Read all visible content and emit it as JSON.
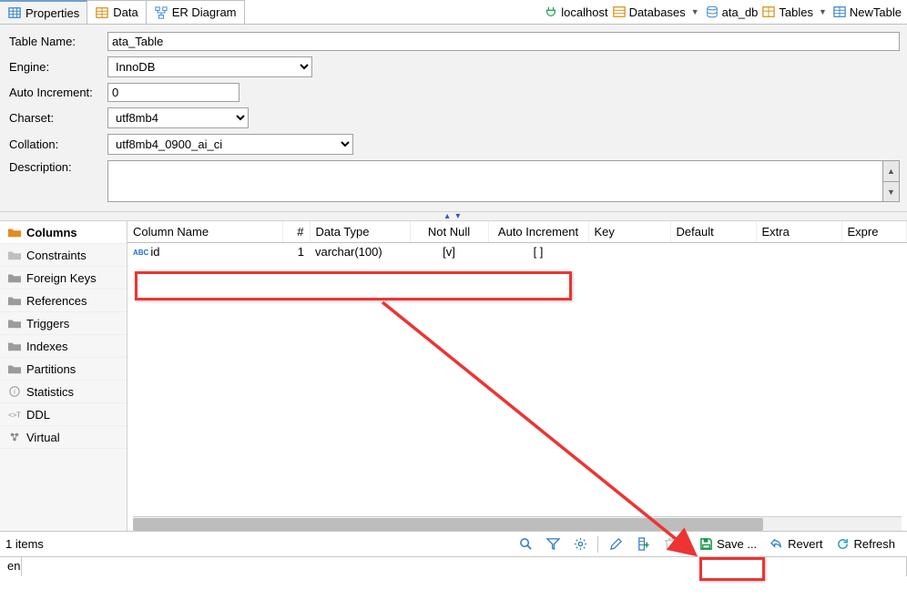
{
  "tabs": {
    "properties": "Properties",
    "data": "Data",
    "er": "ER Diagram"
  },
  "breadcrumb": {
    "conn": "localhost",
    "databases": "Databases",
    "db": "ata_db",
    "tables": "Tables",
    "table": "NewTable"
  },
  "form": {
    "labels": {
      "tablename": "Table Name:",
      "engine": "Engine:",
      "autoinc": "Auto Increment:",
      "charset": "Charset:",
      "collation": "Collation:",
      "description": "Description:"
    },
    "values": {
      "tablename": "ata_Table",
      "engine": "InnoDB",
      "autoinc": "0",
      "charset": "utf8mb4",
      "collation": "utf8mb4_0900_ai_ci",
      "description": ""
    }
  },
  "categories": [
    "Columns",
    "Constraints",
    "Foreign Keys",
    "References",
    "Triggers",
    "Indexes",
    "Partitions",
    "Statistics",
    "DDL",
    "Virtual"
  ],
  "grid": {
    "headers": {
      "name": "Column Name",
      "num": "#",
      "dtype": "Data Type",
      "notnull": "Not Null",
      "autoinc": "Auto Increment",
      "key": "Key",
      "default": "Default",
      "extra": "Extra",
      "expr": "Expre"
    },
    "rows": [
      {
        "icon": "ABC",
        "name": "id",
        "num": "1",
        "dtype": "varchar(100)",
        "notnull": "[v]",
        "autoinc": "[ ]",
        "key": "",
        "default": "",
        "extra": "",
        "expr": ""
      }
    ]
  },
  "statusbar": {
    "count": "1 items",
    "save": "Save ...",
    "revert": "Revert",
    "refresh": "Refresh"
  },
  "bottom": {
    "locale": "en"
  }
}
